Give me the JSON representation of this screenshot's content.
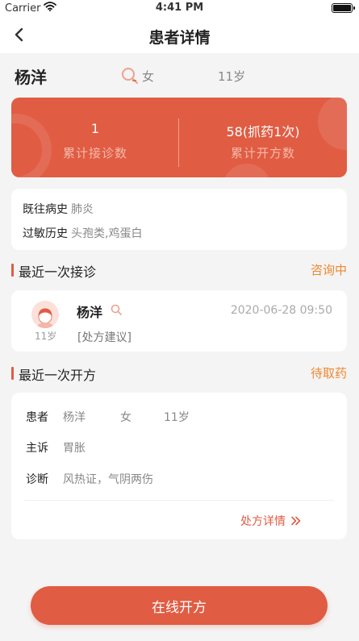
{
  "status_bar": {
    "carrier": "Carrier",
    "time": "4:41 PM"
  },
  "header": {
    "title": "患者详情"
  },
  "patient": {
    "name": "杨洋",
    "sex": "女",
    "age": "11岁"
  },
  "stats": [
    {
      "value": "1",
      "label": "累计接诊数"
    },
    {
      "value": "58(抓药1次)",
      "label": "累计开方数"
    }
  ],
  "history": {
    "past_label": "既往病史",
    "past_value": "肺炎",
    "allergy_label": "过敏历史",
    "allergy_value": "头孢类,鸡蛋白"
  },
  "last_consult": {
    "section_title": "最近一次接诊",
    "status": "咨询中",
    "name": "杨洋",
    "age": "11岁",
    "datetime": "2020-06-28 09:50",
    "type": "[处方建议]"
  },
  "last_prescription": {
    "section_title": "最近一次开方",
    "status": "待取药",
    "patient_label": "患者",
    "patient_name": "杨洋",
    "patient_sex": "女",
    "patient_age": "11岁",
    "complaint_label": "主诉",
    "complaint_value": "胃胀",
    "diagnosis_label": "诊断",
    "diagnosis_value": "风热证，气阴两伤",
    "detail_link": "处方详情"
  },
  "action": {
    "label": "在线开方"
  },
  "colors": {
    "accent": "#e05c43",
    "status_orange": "#f0872f",
    "muted": "#888888",
    "background": "#f4f4f4"
  },
  "icons": {
    "back": "chevron-left-icon",
    "search": "search-icon",
    "wifi": "wifi-icon",
    "battery": "battery-icon",
    "avatar": "avatar-icon",
    "more": "double-chevron-right-icon"
  }
}
